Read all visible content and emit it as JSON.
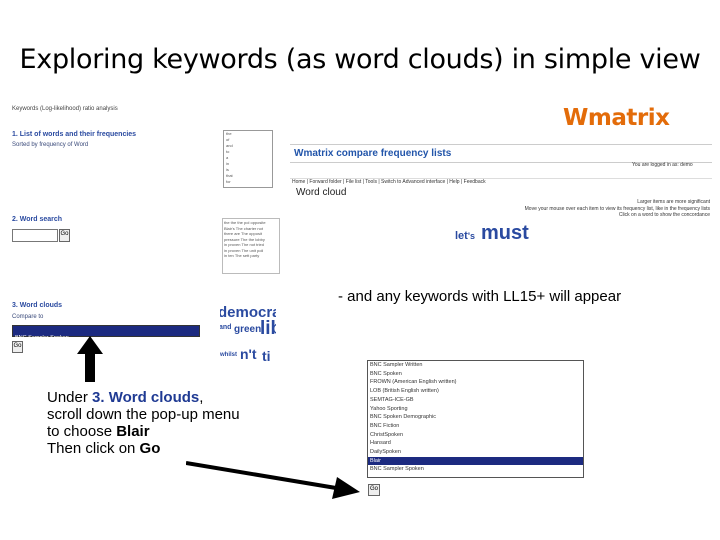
{
  "slide": {
    "title": "Exploring keywords (as word clouds) in simple view"
  },
  "left_panel": {
    "header_line": "Keywords (Log-likelihood) ratio analysis",
    "section1_title": "1. List of words and their frequencies",
    "section1_sort": "Sorted by frequency of Word",
    "list1_items": [
      "the",
      "of",
      "and",
      "to",
      "a",
      "in",
      "is",
      "that",
      "for"
    ],
    "section2_title": "2. Word search",
    "search_go": "Go",
    "blur_lines": [
      "the the the pol opposite",
      "Blair's The charter not",
      "there are The opposit",
      "pressure The the lobby",
      "in proven The not tried",
      "in proven The unit poli",
      "in ten The sett party"
    ],
    "section3_title": "3. Word clouds",
    "section3_sub": "Compare to",
    "select_value": "BNC Sampler Spoken",
    "go_label": "Go"
  },
  "cloud_fragment": {
    "words": [
      "democrat",
      "and",
      "green",
      "lib",
      "whilst",
      "n't",
      "ti"
    ]
  },
  "wmatrix": {
    "logo": "Wmatrix",
    "header": "Wmatrix compare frequency lists",
    "logged_in": "You are logged in as: demo",
    "nav": "Home | Forward folder | File list | Tools | Switch to Advanced interface | Help | Feedback",
    "page_heading": "Word cloud",
    "notes": [
      "Larger items are more significant",
      "Move your mouse over each item to view its frequency list, like in the frequency lists",
      "Click on a word to show the concordance"
    ],
    "cloud_words": [
      "let",
      "'s",
      "must"
    ]
  },
  "annotations": {
    "ll_note": "- and any keywords with LL15+ will appear",
    "caption_line1_prefix": "Under ",
    "caption_line1_highlight": "3. Word clouds",
    "caption_line1_suffix": ",",
    "caption_line2": "scroll down the pop-up menu",
    "caption_line3_prefix": "to choose ",
    "caption_line3_bold": "Blair",
    "caption_line4_prefix": "Then click on ",
    "caption_line4_bold": "Go"
  },
  "dropdown": {
    "options": [
      "BNC Sampler Written",
      "BNC Spoken",
      "FROWN (American English written)",
      "LOB (British English written)",
      "SEMTAG-ICE-GB",
      "Yahoo Sporting",
      "BNC Spoken Demographic",
      "BNC Fiction",
      "ChristSpoken",
      "Hansard",
      "DailySpoken",
      "Blair",
      "BNC Sampler Spoken"
    ],
    "selected": "Blair",
    "go_label": "Go"
  },
  "colors": {
    "accent_orange": "#e36c0a",
    "link_blue": "#2255aa",
    "selection_navy": "#1c2a80",
    "caption_highlight": "#1f3a93"
  }
}
